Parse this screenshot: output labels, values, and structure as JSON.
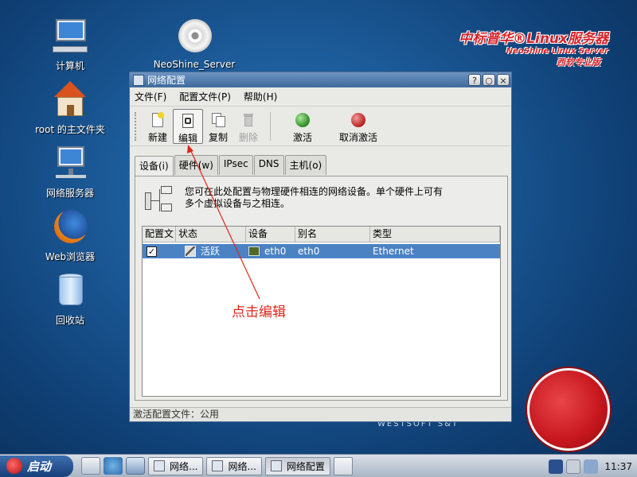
{
  "desktop": {
    "icons": [
      {
        "label": "计算机"
      },
      {
        "label": "root 的主文件夹"
      },
      {
        "label": "网络服务器"
      },
      {
        "label": "Web浏览器"
      },
      {
        "label": "回收站"
      },
      {
        "label": "NeoShine_Server"
      }
    ],
    "brand": {
      "line1": "中标普华®Linux服务器",
      "line2": "NeoShine Linux Server",
      "line3": "西软专业版"
    },
    "watermark": "WESTSOFT S&T",
    "annotation": "点击编辑"
  },
  "window": {
    "title": "网络配置",
    "menu": [
      "文件(F)",
      "配置文件(P)",
      "帮助(H)"
    ],
    "toolbar": {
      "new": "新建",
      "edit": "编辑",
      "copy": "复制",
      "delete": "删除",
      "activate": "激活",
      "deactivate": "取消激活"
    },
    "tabs": [
      "设备(i)",
      "硬件(w)",
      "IPsec",
      "DNS",
      "主机(o)"
    ],
    "info_text": "您可在此处配置与物理硬件相连的网络设备。单个硬件上可有多个虚拟设备与之相连。",
    "table": {
      "headers": [
        "配置文",
        "状态",
        "设备",
        "别名",
        "类型"
      ],
      "rows": [
        {
          "checked": "✓",
          "status": "活跃",
          "device": "eth0",
          "alias": "eth0",
          "type": "Ethernet"
        }
      ]
    },
    "statusbar": "激活配置文件：公用"
  },
  "taskbar": {
    "start": "启动",
    "tasks": [
      "网络...",
      "网络...",
      "网络配置"
    ],
    "clock": "11:37"
  },
  "colors": {
    "accent": "#4b82c4",
    "annotation": "#e0261c",
    "brand": "#d8232a"
  }
}
